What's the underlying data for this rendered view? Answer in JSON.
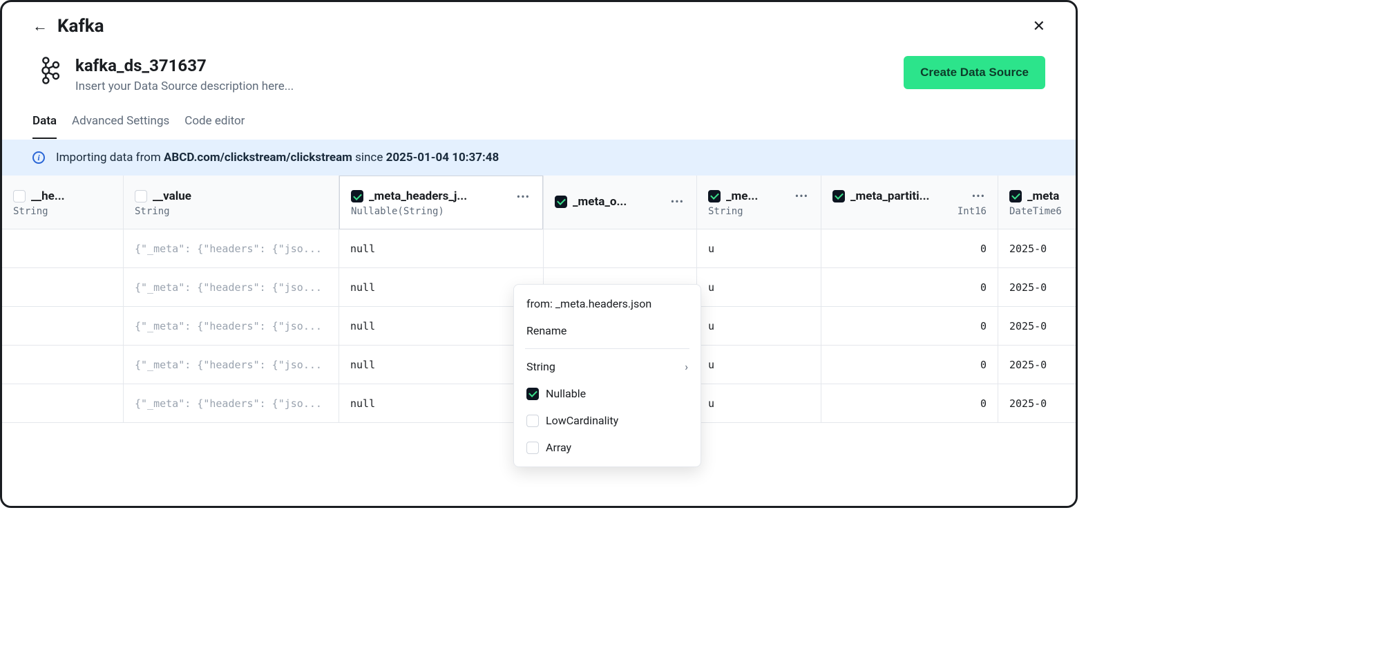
{
  "page": {
    "title": "Kafka"
  },
  "header": {
    "ds_name": "kafka_ds_371637",
    "ds_desc": "Insert your Data Source description here...",
    "create_btn": "Create Data Source"
  },
  "tabs": {
    "data": "Data",
    "advanced": "Advanced Settings",
    "code": "Code editor"
  },
  "banner": {
    "prefix": "Importing data from ",
    "source": "ABCD.com/clickstream/clickstream",
    "middle": " since ",
    "since": "2025-01-04 10:37:48"
  },
  "columns": [
    {
      "name": "__he...",
      "type": "String",
      "checked": false,
      "dots": false
    },
    {
      "name": "__value",
      "type": "String",
      "checked": false,
      "dots": false
    },
    {
      "name": "_meta_headers_j...",
      "type": "Nullable(String)",
      "checked": true,
      "dots": true,
      "active": true
    },
    {
      "name": "_meta_o...",
      "type": "",
      "checked": true,
      "dots": true
    },
    {
      "name": "_me...",
      "type": "String",
      "checked": true,
      "dots": true
    },
    {
      "name": "_meta_partiti...",
      "type": "Int16",
      "checked": true,
      "dots": true,
      "type_right": true
    },
    {
      "name": "_meta",
      "type": "DateTime6",
      "checked": true,
      "dots": false
    }
  ],
  "rows": [
    {
      "c0": "",
      "c1": "{\"_meta\": {\"headers\": {\"jso...",
      "c2": "null",
      "c3": "",
      "c4": "u",
      "c5": "0",
      "c6": "2025-0"
    },
    {
      "c0": "",
      "c1": "{\"_meta\": {\"headers\": {\"jso...",
      "c2": "null",
      "c3": "",
      "c4": "u",
      "c5": "0",
      "c6": "2025-0"
    },
    {
      "c0": "",
      "c1": "{\"_meta\": {\"headers\": {\"jso...",
      "c2": "null",
      "c3": "",
      "c4": "u",
      "c5": "0",
      "c6": "2025-0"
    },
    {
      "c0": "",
      "c1": "{\"_meta\": {\"headers\": {\"jso...",
      "c2": "null",
      "c3": "",
      "c4": "u",
      "c5": "0",
      "c6": "2025-0"
    },
    {
      "c0": "",
      "c1": "{\"_meta\": {\"headers\": {\"jso...",
      "c2": "null",
      "c3": "",
      "c4": "u",
      "c5": "0",
      "c6": "2025-0"
    }
  ],
  "menu": {
    "from": "from: _meta.headers.json",
    "rename": "Rename",
    "type": "String",
    "nullable": "Nullable",
    "lowcard": "LowCardinality",
    "array": "Array"
  }
}
